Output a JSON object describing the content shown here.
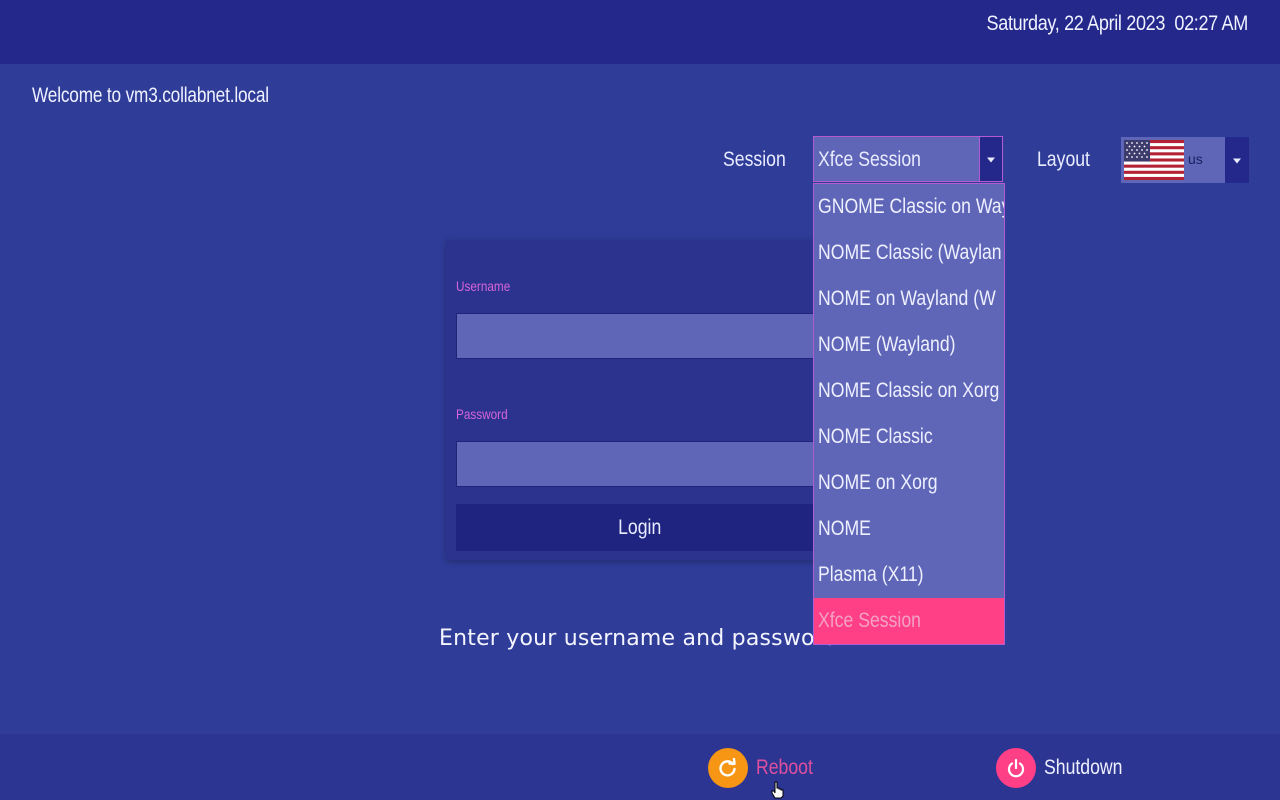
{
  "header": {
    "datetime": "Saturday, 22 April 2023  02:27 AM"
  },
  "welcome": "Welcome to vm3.collabnet.local",
  "session": {
    "label": "Session",
    "selected": "Xfce Session",
    "options": [
      "GNOME Classic on Wayl",
      "NOME Classic (Waylan",
      "NOME on Wayland (W",
      "NOME (Wayland)",
      "NOME Classic on Xorg",
      "NOME Classic",
      "NOME on Xorg",
      "NOME",
      "Plasma (X11)",
      "Xfce Session"
    ],
    "highlighted_index": 9
  },
  "layout": {
    "label": "Layout",
    "code": "us"
  },
  "login": {
    "username_label": "Username",
    "username_value": "",
    "password_label": "Password",
    "password_value": "",
    "button_label": "Login",
    "prompt": "Enter your username and password"
  },
  "power": {
    "reboot_label": "Reboot",
    "shutdown_label": "Shutdown"
  },
  "colors": {
    "background": "#2f3c98",
    "topbar": "#23288a",
    "field": "#5f66b7",
    "accent_pink": "#ff3f86",
    "accent_orange": "#f79515",
    "label_pink": "#d764d8"
  },
  "icons": {
    "reboot": "refresh-icon",
    "shutdown": "power-icon",
    "layout_flag": "us-flag-icon",
    "dropdown": "caret-down-icon"
  }
}
